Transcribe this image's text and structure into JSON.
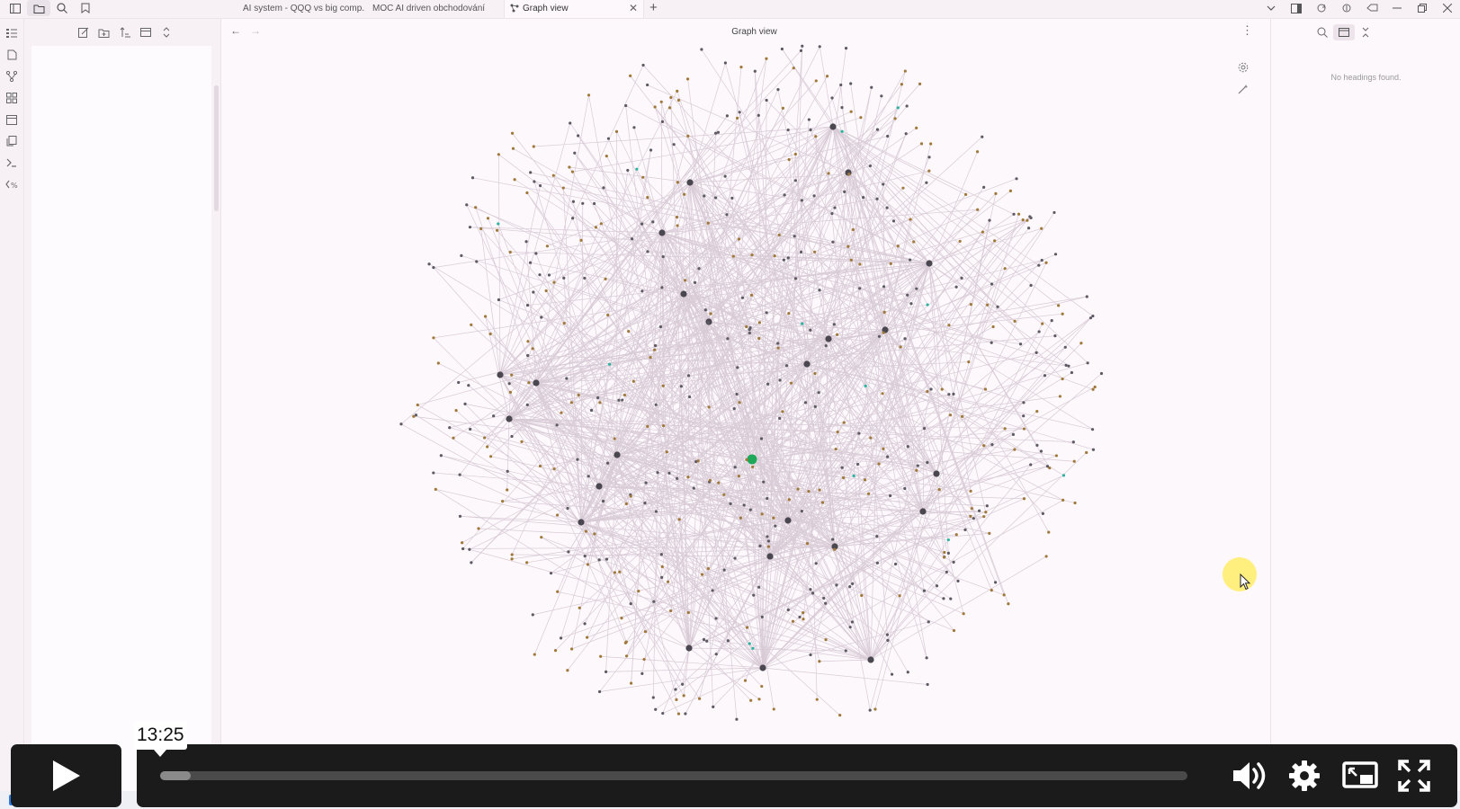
{
  "tabs": [
    {
      "label": "AI system - QQQ vs big comp..."
    },
    {
      "label": "MOC AI driven obchodování"
    },
    {
      "label": "Graph view",
      "close": "✕"
    }
  ],
  "new_tab": "+",
  "main": {
    "title": "Graph view",
    "back": "←",
    "forward": "→",
    "more": "⋮"
  },
  "outline": {
    "empty_text": "No headings found."
  },
  "player": {
    "time_tooltip": "13:25",
    "progress_fraction": 0.03
  },
  "graph": {
    "colors": {
      "edge": "#d8cbd6",
      "hub": "#4a4750",
      "active": "#1ea85a",
      "tag": "#a0793a",
      "attachment": "#2bb3a0",
      "note": "#5d5a63"
    }
  },
  "icons": {
    "left_toggle": "sidebar-toggle-icon",
    "files": "folder-icon",
    "search": "search-icon",
    "bookmark": "bookmark-icon"
  }
}
